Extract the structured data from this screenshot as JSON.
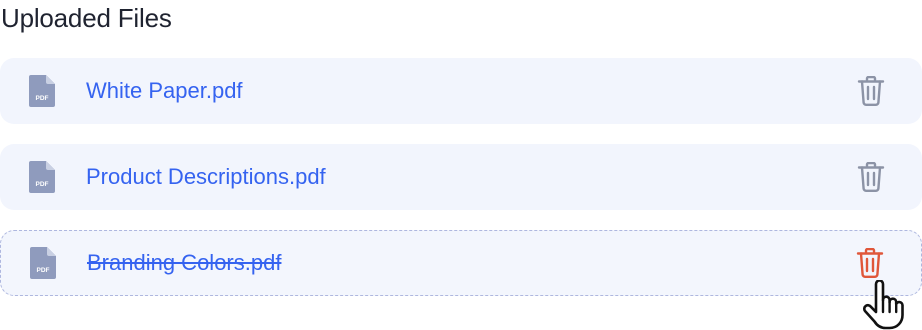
{
  "section": {
    "title": "Uploaded Files"
  },
  "files": [
    {
      "name": "White Paper.pdf",
      "icon_label": "PDF",
      "state": "normal"
    },
    {
      "name": "Product Descriptions.pdf",
      "icon_label": "PDF",
      "state": "normal"
    },
    {
      "name": "Branding Colors.pdf",
      "icon_label": "PDF",
      "state": "removing"
    }
  ],
  "icons": {
    "file": "pdf-file-icon",
    "delete": "trash-icon",
    "cursor": "hand-pointer-icon"
  },
  "colors": {
    "row_background": "#f2f5fd",
    "file_link": "#3563f0",
    "trash_default": "#8c93a6",
    "trash_hover": "#e0573a",
    "file_icon": "#8f9bbd",
    "dashed_border": "#aeb7df"
  }
}
